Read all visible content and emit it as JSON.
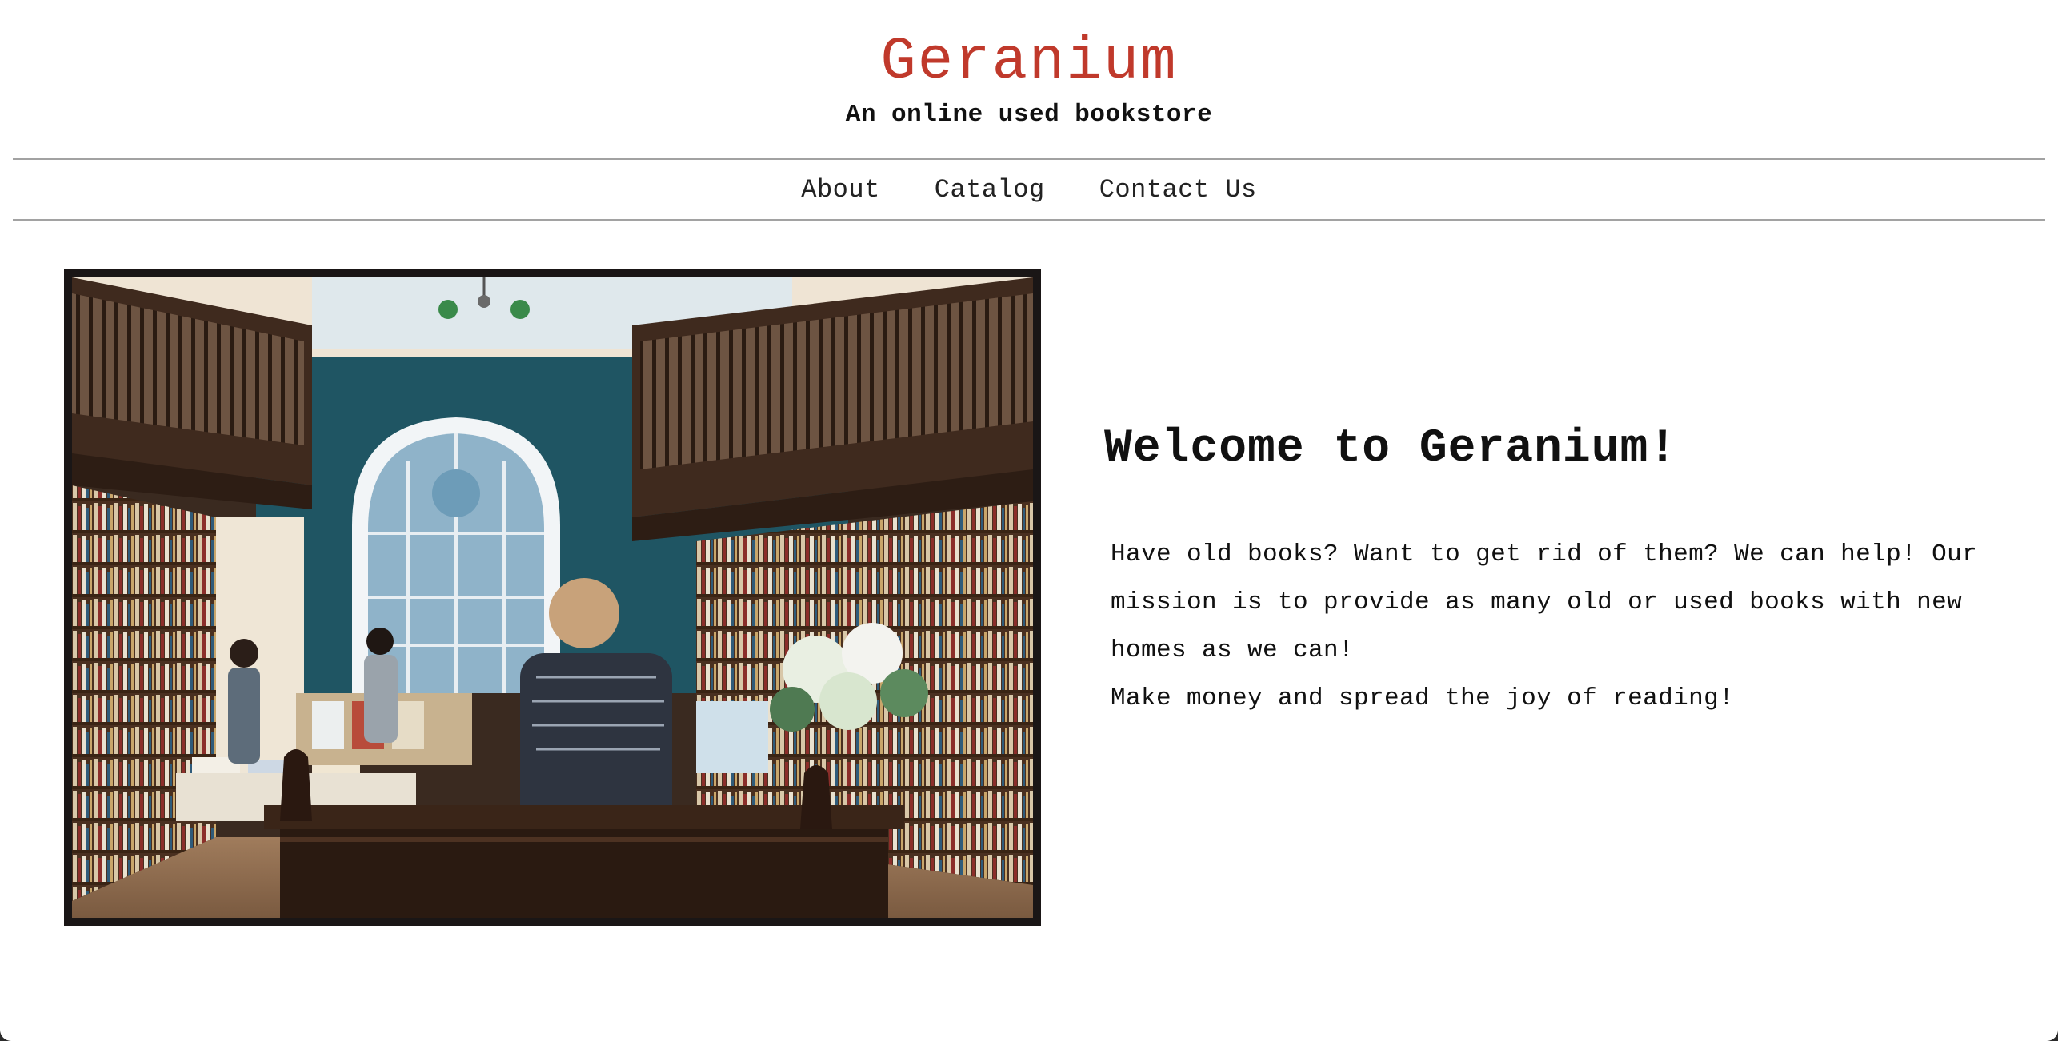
{
  "header": {
    "title": "Geranium",
    "subtitle": "An online used bookstore",
    "brand_color": "#c0392b"
  },
  "nav": {
    "items": [
      "About",
      "Catalog",
      "Contact Us"
    ]
  },
  "hero": {
    "image_icon": "bookstore-interior-photo"
  },
  "main": {
    "heading": "Welcome to Geranium!",
    "paragraphs": [
      "Have old books? Want to get rid of them? We can help! Our mission is to provide as many old or used books with new homes as we can!",
      "Make money and spread the joy of reading!"
    ]
  }
}
